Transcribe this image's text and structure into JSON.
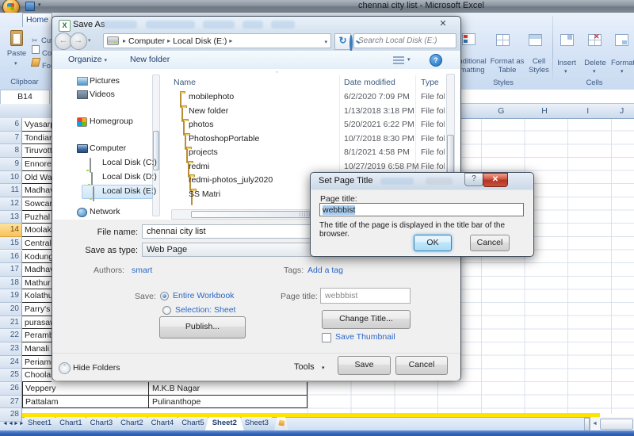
{
  "window": {
    "title": "chennai city list - Microsoft Excel"
  },
  "icons": {
    "close": "✕",
    "help": "?",
    "caret_down": "▾",
    "crumb_sep": "▸",
    "refresh": "↻",
    "back": "←",
    "forward": "→",
    "sort_asc": "ˆ",
    "nav_first": "◄",
    "nav_prev": "◄",
    "nav_next": "►",
    "nav_last": "►",
    "scroll_left": "◄"
  },
  "ribbon": {
    "home_tab": "Home",
    "clipboard": {
      "paste": "Paste",
      "cut": "Cut",
      "copy": "Cop",
      "format": "For",
      "group": "Clipboar"
    },
    "styles": {
      "cf1": "nditional",
      "cf2": "matting",
      "fat1": "Format as",
      "fat2": "Table",
      "cs1": "Cell",
      "cs2": "Styles",
      "group": "Styles"
    },
    "cells": {
      "insert": "Insert",
      "delete": "Delete",
      "format": "Format",
      "group": "Cells"
    }
  },
  "formula_bar": {
    "name_box": "B14"
  },
  "grid": {
    "visible_columns": [
      "G",
      "H",
      "I",
      "J"
    ],
    "active_row": "14",
    "rows": [
      {
        "n": "6",
        "a": "Vyasarp"
      },
      {
        "n": "7",
        "a": "Tondiar"
      },
      {
        "n": "8",
        "a": "Tiruvott"
      },
      {
        "n": "9",
        "a": "Ennore"
      },
      {
        "n": "10",
        "a": "Old Was"
      },
      {
        "n": "11",
        "a": "Madhav"
      },
      {
        "n": "12",
        "a": "Sowcarp"
      },
      {
        "n": "13",
        "a": "Puzhal"
      },
      {
        "n": "14",
        "a": "Moolaka"
      },
      {
        "n": "15",
        "a": "Central"
      },
      {
        "n": "16",
        "a": "Kodunga"
      },
      {
        "n": "17",
        "a": "Madhav"
      },
      {
        "n": "18",
        "a": "Mathur"
      },
      {
        "n": "19",
        "a": "Kolathu"
      },
      {
        "n": "20",
        "a": "Parry's"
      },
      {
        "n": "21",
        "a": "purasaw"
      },
      {
        "n": "22",
        "a": "Peramb"
      },
      {
        "n": "23",
        "a": "Manali"
      },
      {
        "n": "24",
        "a": "Periame"
      },
      {
        "n": "25",
        "a": "Choolai"
      },
      {
        "n": "26",
        "a": "Veppery",
        "b": "M.K.B Nagar"
      },
      {
        "n": "27",
        "a": "Pattalam",
        "b": "Pulinanthope"
      },
      {
        "n": "28"
      }
    ]
  },
  "sheet_tabs": {
    "tabs": [
      "Sheet1",
      "Chart1",
      "Chart3",
      "Chart2",
      "Chart4",
      "Chart5",
      "Sheet2",
      "Sheet3"
    ],
    "active": "Sheet2"
  },
  "save_dialog": {
    "title": "Save As",
    "breadcrumb": {
      "items": [
        "Computer",
        "Local Disk (E:)"
      ]
    },
    "search_placeholder": "Search Local Disk (E:)",
    "toolbar": {
      "organize": "Organize",
      "new_folder": "New folder"
    },
    "sidebar": [
      {
        "label": "Pictures",
        "icon": "pictures"
      },
      {
        "label": "Videos",
        "icon": "videos"
      },
      {
        "label": "Homegroup",
        "icon": "homegroup"
      },
      {
        "label": "Computer",
        "icon": "computer"
      },
      {
        "label": "Local Disk (C:)",
        "icon": "disk"
      },
      {
        "label": "Local Disk (D:)",
        "icon": "disk"
      },
      {
        "label": "Local Disk (E:)",
        "icon": "disk",
        "selected": true
      },
      {
        "label": "Network",
        "icon": "network"
      }
    ],
    "list": {
      "columns": [
        "Name",
        "Date modified",
        "Type"
      ],
      "items": [
        {
          "name": "mobilephoto",
          "date": "6/2/2020 7:09 PM",
          "type": "File fol"
        },
        {
          "name": "New folder",
          "date": "1/13/2018 3:18 PM",
          "type": "File fol"
        },
        {
          "name": "photos",
          "date": "5/20/2021 6:22 PM",
          "type": "File fol"
        },
        {
          "name": "PhotoshopPortable",
          "date": "10/7/2018 8:30 PM",
          "type": "File fol"
        },
        {
          "name": "projects",
          "date": "8/1/2021 4:58 PM",
          "type": "File fol"
        },
        {
          "name": "redmi",
          "date": "10/27/2019 6:58 PM",
          "type": "File fol"
        },
        {
          "name": "redmi-photos_july2020",
          "date": "",
          "type": ""
        },
        {
          "name": "SS Matri",
          "date": "",
          "type": ""
        }
      ]
    },
    "file_name_label": "File name:",
    "file_name_value": "chennai city list",
    "save_type_label": "Save as type:",
    "save_type_value": "Web Page",
    "authors_label": "Authors:",
    "authors_value": "smart",
    "tags_label": "Tags:",
    "tags_value": "Add a tag",
    "save_label": "Save:",
    "option_workbook": "Entire Workbook",
    "option_selection": "Selection: Sheet",
    "publish": "Publish...",
    "page_title_label": "Page title:",
    "page_title_value": "webbbist",
    "change_title": "Change Title...",
    "save_thumbnail": "Save Thumbnail",
    "hide_folders": "Hide Folders",
    "tools": "Tools",
    "save_button": "Save",
    "cancel_button": "Cancel"
  },
  "title_dialog": {
    "title": "Set Page Title",
    "label": "Page title:",
    "value": "webbbist",
    "caption": "The title of the page is displayed in the title bar of the browser.",
    "ok": "OK",
    "cancel": "Cancel"
  },
  "colors": {
    "accent_blue": "#2a67c6",
    "selection": "#a8cdf0",
    "tab_yellow": "#ffe400",
    "status_blue": "#3465bb"
  }
}
